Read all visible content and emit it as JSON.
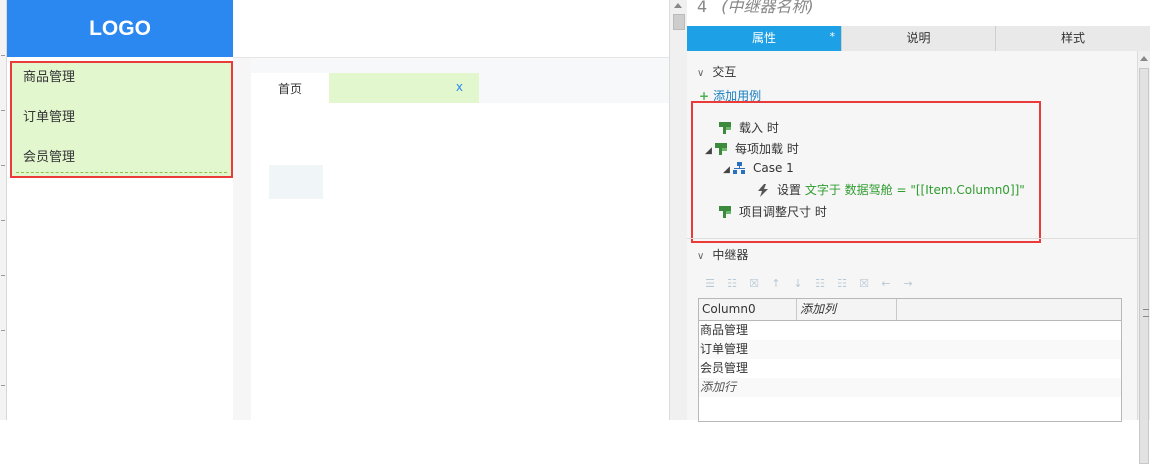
{
  "canvas": {
    "logo": "LOGO",
    "menu_items": [
      "商品管理",
      "订单管理",
      "会员管理"
    ],
    "tabs": {
      "home": "首页",
      "close": "x"
    }
  },
  "panel": {
    "title_number": "4",
    "title_name": "(中继器名称)",
    "tabs": [
      {
        "label": "属性",
        "active": true,
        "marker": "*"
      },
      {
        "label": "说明",
        "active": false
      },
      {
        "label": "样式",
        "active": false
      }
    ],
    "interaction": {
      "heading": "交互",
      "add_case": "添加用例",
      "events": {
        "on_load": "载入 时",
        "on_item_load": "每项加载 时",
        "case": "Case 1",
        "action_prefix": "设置",
        "action_detail": "文字于 数据驾舱 = \"[[Item.Column0]]\"",
        "on_item_resize": "项目调整尺寸 时"
      }
    },
    "repeater": {
      "heading": "中继器",
      "columns": [
        "Column0",
        "添加列"
      ],
      "rows": [
        "商品管理",
        "订单管理",
        "会员管理"
      ],
      "add_row": "添加行"
    }
  },
  "colors": {
    "logo_bg": "#2b88f0",
    "menu_bg": "#e3f7cf",
    "highlight_border": "#ea3a3a",
    "active_tab": "#1ea0e6"
  }
}
